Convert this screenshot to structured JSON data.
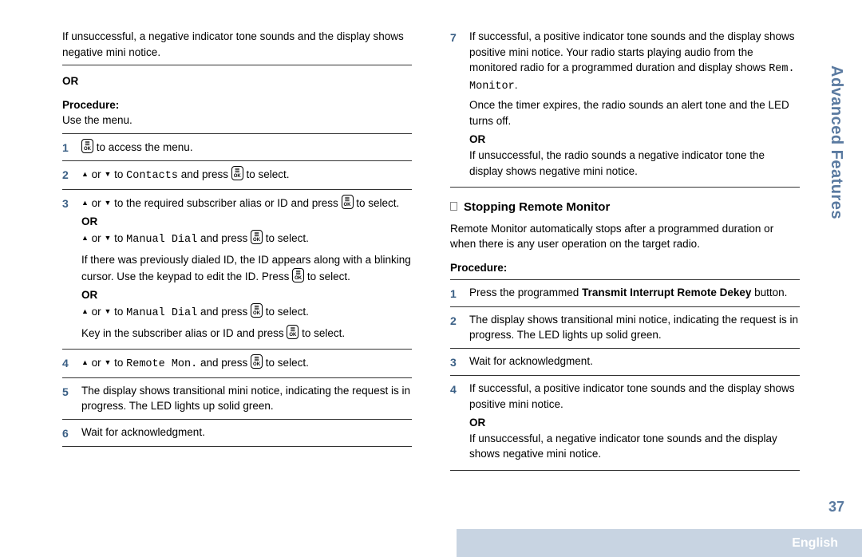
{
  "sideTab": "Advanced Features",
  "pageNumber": "37",
  "language": "English",
  "left": {
    "intro": "If unsuccessful, a negative indicator tone sounds and the display shows negative mini notice.",
    "orLabel": "OR",
    "procedureLabel": "Procedure:",
    "procedureText": "Use the menu.",
    "steps": {
      "s1": " to access the menu.",
      "s2a": " or ",
      "s2b": " to ",
      "s2c": "Contacts",
      "s2d": " and press ",
      "s2e": " to select.",
      "s3a": " or ",
      "s3b": " to the required subscriber alias or ID and press ",
      "s3c": " to select.",
      "s3or1": "OR",
      "s3d": " or ",
      "s3e": " to ",
      "s3f": "Manual Dial",
      "s3g": " and press ",
      "s3h": " to select.",
      "s3i": "If there was previously dialed ID, the ID appears along with a blinking cursor. Use the keypad to edit the ID. Press ",
      "s3j": " to select.",
      "s3or2": "OR",
      "s3k": " or ",
      "s3l": " to ",
      "s3m": "Manual Dial",
      "s3n": " and press ",
      "s3o": " to select.",
      "s3p": " Key in the subscriber alias or ID and press ",
      "s3q": " to select.",
      "s4a": " or ",
      "s4b": " to ",
      "s4c": "Remote Mon.",
      "s4d": " and press ",
      "s4e": " to select.",
      "s5": "The display shows transitional mini notice, indicating the request is in progress. The LED lights up solid green.",
      "s6": "Wait for acknowledgment."
    }
  },
  "right": {
    "s7a": "If successful, a positive indicator tone sounds and the display shows positive mini notice. Your radio starts playing audio from the monitored radio for a programmed duration and display shows ",
    "s7b": "Rem. Monitor",
    "s7c": ".",
    "s7d": "Once the timer expires, the radio sounds an alert tone and the LED turns off.",
    "s7or": "OR",
    "s7e": "If unsuccessful, the radio sounds a negative indicator tone the display shows negative mini notice.",
    "h2": "Stopping Remote Monitor",
    "intro": "Remote Monitor automatically stops after a programmed duration or when there is any user operation on the target radio.",
    "procedureLabel": "Procedure:",
    "steps": {
      "s1a": "Press the programmed ",
      "s1b": "Transmit Interrupt Remote Dekey",
      "s1c": " button.",
      "s2": "The display shows transitional mini notice, indicating the request is in progress. The LED lights up solid green.",
      "s3": "Wait for acknowledgment.",
      "s4a": "If successful, a positive indicator tone sounds and the display shows positive mini notice.",
      "s4or": "OR",
      "s4b": "If unsuccessful, a negative indicator tone sounds and the display shows negative mini notice."
    }
  }
}
